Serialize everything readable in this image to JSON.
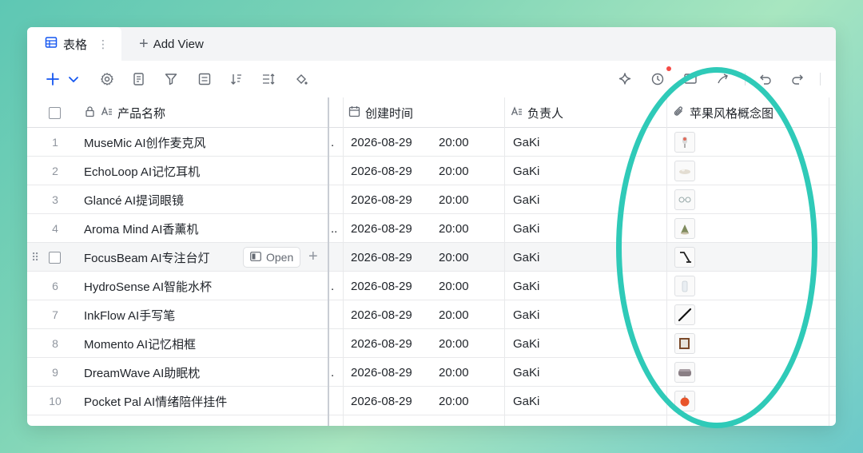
{
  "tabs": {
    "active_label": "表格",
    "more_glyph": "⋮",
    "add_view_label": "Add View"
  },
  "toolbar": {
    "left_icons": [
      "plus-icon",
      "chevron-down-icon",
      "settings-icon",
      "form-icon",
      "filter-icon",
      "group-icon",
      "sort-icon",
      "row-height-icon",
      "fill-color-icon"
    ],
    "right_icons": [
      "ai-sparkle-icon",
      "history-icon",
      "screen-icon",
      "share-icon",
      "undo-icon",
      "redo-icon"
    ],
    "notification_color": "#f54a45"
  },
  "columns": {
    "name": "产品名称",
    "created": "创建时间",
    "owner": "负责人",
    "image": "苹果风格概念图"
  },
  "rows": [
    {
      "num": "1",
      "name": "MuseMic AI创作麦克风",
      "date": "2026-08-29",
      "time": "20:00",
      "owner": "GaKi",
      "ellipsis": ".",
      "thumb": "mic"
    },
    {
      "num": "2",
      "name": "EchoLoop AI记忆耳机",
      "date": "2026-08-29",
      "time": "20:00",
      "owner": "GaKi",
      "ellipsis": "",
      "thumb": "earbuds"
    },
    {
      "num": "3",
      "name": "Glancé AI提词眼镜",
      "date": "2026-08-29",
      "time": "20:00",
      "owner": "GaKi",
      "ellipsis": "",
      "thumb": "glasses"
    },
    {
      "num": "4",
      "name": "Aroma Mind AI香薰机",
      "date": "2026-08-29",
      "time": "20:00",
      "owner": "GaKi",
      "ellipsis": "..",
      "thumb": "diffuser"
    },
    {
      "num": "",
      "name": "FocusBeam AI专注台灯",
      "date": "2026-08-29",
      "time": "20:00",
      "owner": "GaKi",
      "ellipsis": "",
      "thumb": "lamp",
      "open_label": "Open"
    },
    {
      "num": "6",
      "name": "HydroSense AI智能水杯",
      "date": "2026-08-29",
      "time": "20:00",
      "owner": "GaKi",
      "ellipsis": ".",
      "thumb": "bottle"
    },
    {
      "num": "7",
      "name": "InkFlow AI手写笔",
      "date": "2026-08-29",
      "time": "20:00",
      "owner": "GaKi",
      "ellipsis": "",
      "thumb": "pen"
    },
    {
      "num": "8",
      "name": "Momento AI记忆相框",
      "date": "2026-08-29",
      "time": "20:00",
      "owner": "GaKi",
      "ellipsis": "",
      "thumb": "frame"
    },
    {
      "num": "9",
      "name": "DreamWave AI助眠枕",
      "date": "2026-08-29",
      "time": "20:00",
      "owner": "GaKi",
      "ellipsis": ".",
      "thumb": "pillow"
    },
    {
      "num": "10",
      "name": "Pocket Pal AI情绪陪伴挂件",
      "date": "2026-08-29",
      "time": "20:00",
      "owner": "GaKi",
      "ellipsis": "",
      "thumb": "pendant"
    }
  ],
  "colors": {
    "accent": "#1456f0",
    "highlight_ellipse": "#2fcab8"
  }
}
